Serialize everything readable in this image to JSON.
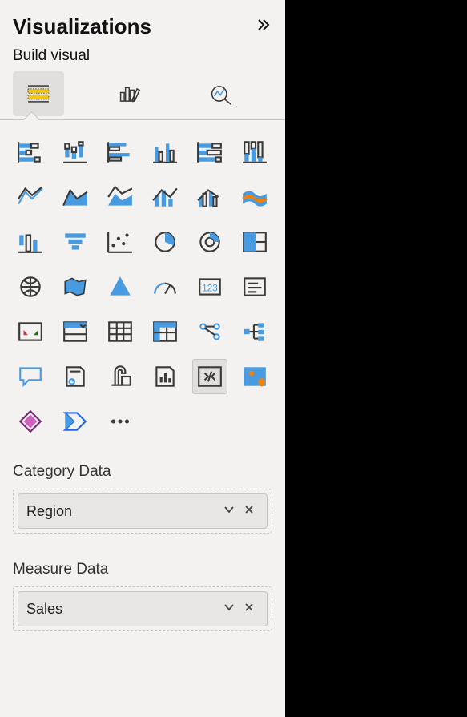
{
  "pane": {
    "title": "Visualizations",
    "sub_title": "Build visual"
  },
  "mode_tabs": [
    {
      "name": "build-visual",
      "selected": true,
      "icon": "build-icon"
    },
    {
      "name": "format-visual",
      "selected": false,
      "icon": "format-icon"
    },
    {
      "name": "analytics",
      "selected": false,
      "icon": "analytics-icon"
    }
  ],
  "field_wells": [
    {
      "label": "Category Data",
      "field": "Region",
      "name": "category-data"
    },
    {
      "label": "Measure Data",
      "field": "Sales",
      "name": "measure-data"
    }
  ],
  "visuals": [
    {
      "name": "stacked-bar-chart",
      "icon": "bar-stacked-h"
    },
    {
      "name": "stacked-column-chart",
      "icon": "bar-stacked-v"
    },
    {
      "name": "clustered-bar-chart",
      "icon": "bar-clustered-h"
    },
    {
      "name": "clustered-column-chart",
      "icon": "bar-clustered-v"
    },
    {
      "name": "100pct-stacked-bar-chart",
      "icon": "bar-100-h"
    },
    {
      "name": "100pct-stacked-column-chart",
      "icon": "bar-100-v"
    },
    {
      "name": "line-chart",
      "icon": "line"
    },
    {
      "name": "area-chart",
      "icon": "area"
    },
    {
      "name": "stacked-area-chart",
      "icon": "area-stacked"
    },
    {
      "name": "line-stacked-column-chart",
      "icon": "line-col"
    },
    {
      "name": "line-clustered-column-chart",
      "icon": "line-col2"
    },
    {
      "name": "ribbon-chart",
      "icon": "ribbon"
    },
    {
      "name": "waterfall-chart",
      "icon": "waterfall"
    },
    {
      "name": "funnel-chart",
      "icon": "funnel"
    },
    {
      "name": "scatter-chart",
      "icon": "scatter"
    },
    {
      "name": "pie-chart",
      "icon": "pie"
    },
    {
      "name": "donut-chart",
      "icon": "donut"
    },
    {
      "name": "treemap",
      "icon": "treemap"
    },
    {
      "name": "map",
      "icon": "map"
    },
    {
      "name": "filled-map",
      "icon": "filled-map"
    },
    {
      "name": "azure-map",
      "icon": "azure-map"
    },
    {
      "name": "gauge",
      "icon": "gauge"
    },
    {
      "name": "card",
      "icon": "card"
    },
    {
      "name": "multi-row-card",
      "icon": "multi-card"
    },
    {
      "name": "kpi",
      "icon": "kpi"
    },
    {
      "name": "slicer",
      "icon": "slicer"
    },
    {
      "name": "table",
      "icon": "table"
    },
    {
      "name": "matrix",
      "icon": "matrix"
    },
    {
      "name": "r-visual",
      "icon": "r-visual"
    },
    {
      "name": "decomposition-tree",
      "icon": "decomp"
    },
    {
      "name": "qna",
      "icon": "qna"
    },
    {
      "name": "paginated-report",
      "icon": "paginated"
    },
    {
      "name": "goals",
      "icon": "goals"
    },
    {
      "name": "smart-narrative",
      "icon": "narrative"
    },
    {
      "name": "python-visual",
      "icon": "py-visual",
      "selected": true
    },
    {
      "name": "arcgis-map",
      "icon": "arcgis"
    },
    {
      "name": "power-apps",
      "icon": "power-apps"
    },
    {
      "name": "power-automate",
      "icon": "power-automate"
    },
    {
      "name": "get-more-visuals",
      "icon": "ellipsis"
    }
  ]
}
